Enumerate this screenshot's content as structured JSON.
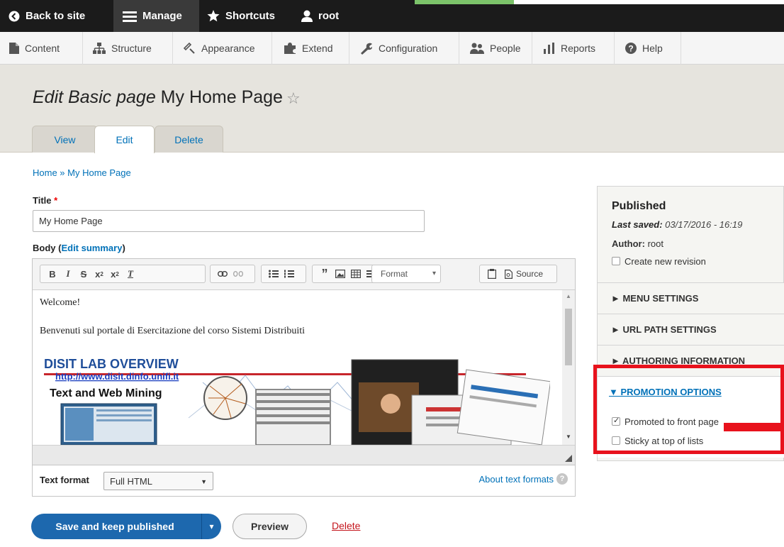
{
  "adminbar": {
    "back_to_site": "Back to site",
    "manage": "Manage",
    "shortcuts": "Shortcuts",
    "user": "root"
  },
  "tray": {
    "content": "Content",
    "structure": "Structure",
    "appearance": "Appearance",
    "extend": "Extend",
    "configuration": "Configuration",
    "people": "People",
    "reports": "Reports",
    "help": "Help"
  },
  "header": {
    "title_italic": "Edit Basic page",
    "title_rest": "My Home Page",
    "tabs": [
      {
        "label": "View"
      },
      {
        "label": "Edit"
      },
      {
        "label": "Delete"
      }
    ]
  },
  "breadcrumb": "Home » My Home Page",
  "form": {
    "title_label": "Title",
    "required_mark": "*",
    "title_value": "My Home Page",
    "body_label": "Body",
    "edit_summary": "Edit summary",
    "format_select": "Format",
    "source_label": "Source",
    "editor_line1": "Welcome!",
    "editor_line2": "Benvenuti sul portale di Esercitazione del corso Sistemi Distribuiti",
    "embedded_image": {
      "title": "DISIT LAB OVERVIEW",
      "url": "http://www.disit.dinfo.unifi.it",
      "subtitle": "Text and Web Mining"
    },
    "text_format_label": "Text format",
    "text_format_value": "Full HTML",
    "about_text_formats": "About text formats"
  },
  "actions": {
    "save": "Save and keep published",
    "preview": "Preview",
    "delete": "Delete"
  },
  "sidebar": {
    "status": "Published",
    "last_saved_label": "Last saved:",
    "last_saved_value": "03/17/2016 - 16:19",
    "author_label": "Author:",
    "author_value": "root",
    "create_revision": "Create new revision",
    "sections": [
      {
        "label": "► MENU SETTINGS"
      },
      {
        "label": "► URL PATH SETTINGS"
      },
      {
        "label": "► AUTHORING INFORMATION"
      }
    ],
    "promotion_title": "▼ PROMOTION OPTIONS",
    "promoted": "Promoted to front page",
    "sticky": "Sticky at top of lists"
  },
  "colors": {
    "admin_bar": "#1b1b1b",
    "link": "#0071b8",
    "primary_button": "#1d68ae",
    "highlight": "#e8121c"
  }
}
